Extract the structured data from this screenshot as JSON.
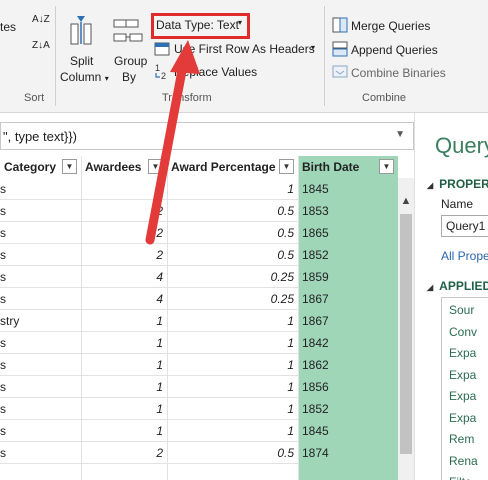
{
  "ribbon": {
    "partial_left": "tes",
    "sort": {
      "asc": "A↓Z",
      "desc": "Z↓A",
      "label": "Sort"
    },
    "split_column": {
      "line1": "Split",
      "line2": "Column"
    },
    "group_by": {
      "line1": "Group",
      "line2": "By"
    },
    "data_type": "Data Type: Text",
    "use_first_row": "Use First Row As Headers",
    "replace_values": "Replace Values",
    "transform_label": "Transform",
    "merge_queries": "Merge Queries",
    "append_queries": "Append Queries",
    "combine_binaries": "Combine Binaries",
    "combine_label": "Combine"
  },
  "formula_bar": {
    "text": "\", type text}})"
  },
  "grid": {
    "headers": [
      "Category",
      "Awardees",
      "Award Percentage",
      "Birth Date"
    ],
    "rows": [
      [
        "s",
        "",
        "1",
        "1845"
      ],
      [
        "s",
        "2",
        "0.5",
        "1853"
      ],
      [
        "s",
        "2",
        "0.5",
        "1865"
      ],
      [
        "s",
        "2",
        "0.5",
        "1852"
      ],
      [
        "s",
        "4",
        "0.25",
        "1859"
      ],
      [
        "s",
        "4",
        "0.25",
        "1867"
      ],
      [
        "stry",
        "1",
        "1",
        "1867"
      ],
      [
        "s",
        "1",
        "1",
        "1842"
      ],
      [
        "s",
        "1",
        "1",
        "1862"
      ],
      [
        "s",
        "1",
        "1",
        "1856"
      ],
      [
        "s",
        "1",
        "1",
        "1852"
      ],
      [
        "s",
        "1",
        "1",
        "1845"
      ],
      [
        "s",
        "2",
        "0.5",
        "1874"
      ],
      [
        "",
        "",
        "",
        ""
      ]
    ]
  },
  "pane": {
    "title": "Query",
    "properties": "PROPER",
    "name_label": "Name",
    "name_value": "Query1",
    "all_properties": "All Prope",
    "applied_steps": "APPLIED",
    "steps": [
      "Sour",
      "Conv",
      "Expa",
      "Expa",
      "Expa",
      "Expa",
      "Rem",
      "Rena",
      "Filte"
    ]
  },
  "colors": {
    "highlight": "#e02b2b",
    "arrow": "#e33a3a",
    "birth_date_column": "#9fd6b8",
    "accent_green": "#3a7f5f"
  }
}
